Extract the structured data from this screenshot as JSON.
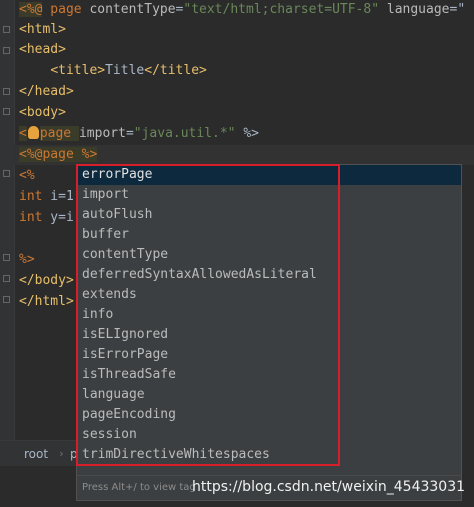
{
  "editor": {
    "lines": [
      {
        "delim": "<%@",
        "kw": " page ",
        "attr1": "contentType",
        "eq1": "=",
        "val1": "\"text/html;charset=UTF-8\"",
        "attr2": " language",
        "eq2": "=\""
      },
      {
        "tag": "<html>"
      },
      {
        "tag": "<head>"
      },
      {
        "indent": "    ",
        "tag1": "<title>",
        "text": "Title",
        "tag2": "</title>"
      },
      {
        "tag": "</head>"
      },
      {
        "tag": "<body>"
      },
      {
        "pre": "<",
        "post": "page ",
        "attr": "import",
        "eq": "=",
        "val": "\"java.util.*\"",
        "end": " %>"
      },
      {
        "delim": "<%@",
        "kw": "page",
        "end": " %>"
      },
      {
        "text": "<%"
      },
      {
        "kw": "int",
        "text": " i=1"
      },
      {
        "kw": "int",
        "text": " y=i"
      },
      {
        "text": ""
      },
      {
        "text": "%>"
      },
      {
        "tag": "</body>"
      },
      {
        "tag": "</html>"
      }
    ]
  },
  "completion": {
    "items": [
      "errorPage",
      "import",
      "autoFlush",
      "buffer",
      "contentType",
      "deferredSyntaxAllowedAsLiteral",
      "extends",
      "info",
      "isELIgnored",
      "isErrorPage",
      "isThreadSafe",
      "language",
      "pageEncoding",
      "session",
      "trimDirectiveWhitespaces"
    ],
    "selected_index": 0,
    "hint": "Press Alt+/ to view tag"
  },
  "breadcrumb": {
    "root": "root",
    "next": "p"
  },
  "watermark": "https://blog.csdn.net/weixin_45433031",
  "colors": {
    "background": "#2b2b2b",
    "tag": "#e8bf6a",
    "keyword": "#cc7832",
    "string": "#6a8759",
    "popup_bg": "#3c3f41",
    "selection": "#0d293e",
    "highlight_box": "#d81e2a"
  }
}
